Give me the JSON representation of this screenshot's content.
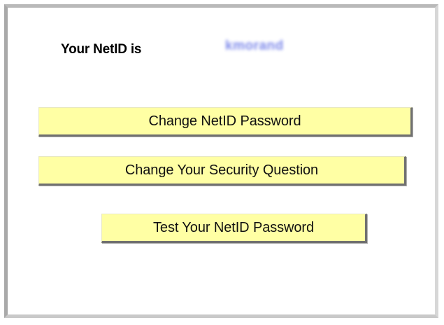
{
  "netid": {
    "label": "Your NetID is",
    "value": "kmorand"
  },
  "actions": {
    "change_password": "Change NetID Password",
    "change_security_question": "Change Your Security Question",
    "test_password": "Test Your NetID Password"
  },
  "colors": {
    "button_background": "#ffffa4",
    "netid_value": "#6f7ce8"
  }
}
